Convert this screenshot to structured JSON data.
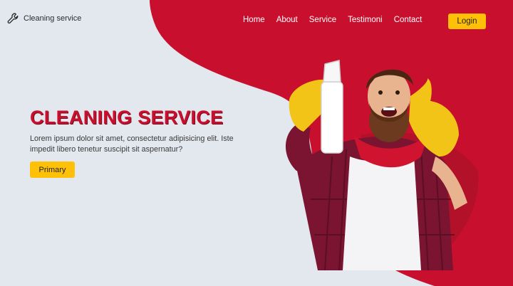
{
  "brand": {
    "name": "Cleaning service",
    "icon": "wrench-icon"
  },
  "nav": {
    "items": [
      {
        "label": "Home"
      },
      {
        "label": "About"
      },
      {
        "label": "Service"
      },
      {
        "label": "Testimoni"
      },
      {
        "label": "Contact"
      }
    ],
    "login_label": "Login"
  },
  "hero": {
    "title": "CLEANING SERVICE",
    "text": "Lorem ipsum dolor sit amet, consectetur adipisicing elit. Iste impedit libero tenetur suscipit sit aspernatur?",
    "button_label": "Primary",
    "image": "man-with-spray-bottle-thumbs-up-photo"
  },
  "colors": {
    "background": "#e3e8ef",
    "accent_red": "#c8102e",
    "button_yellow": "#ffc107"
  }
}
